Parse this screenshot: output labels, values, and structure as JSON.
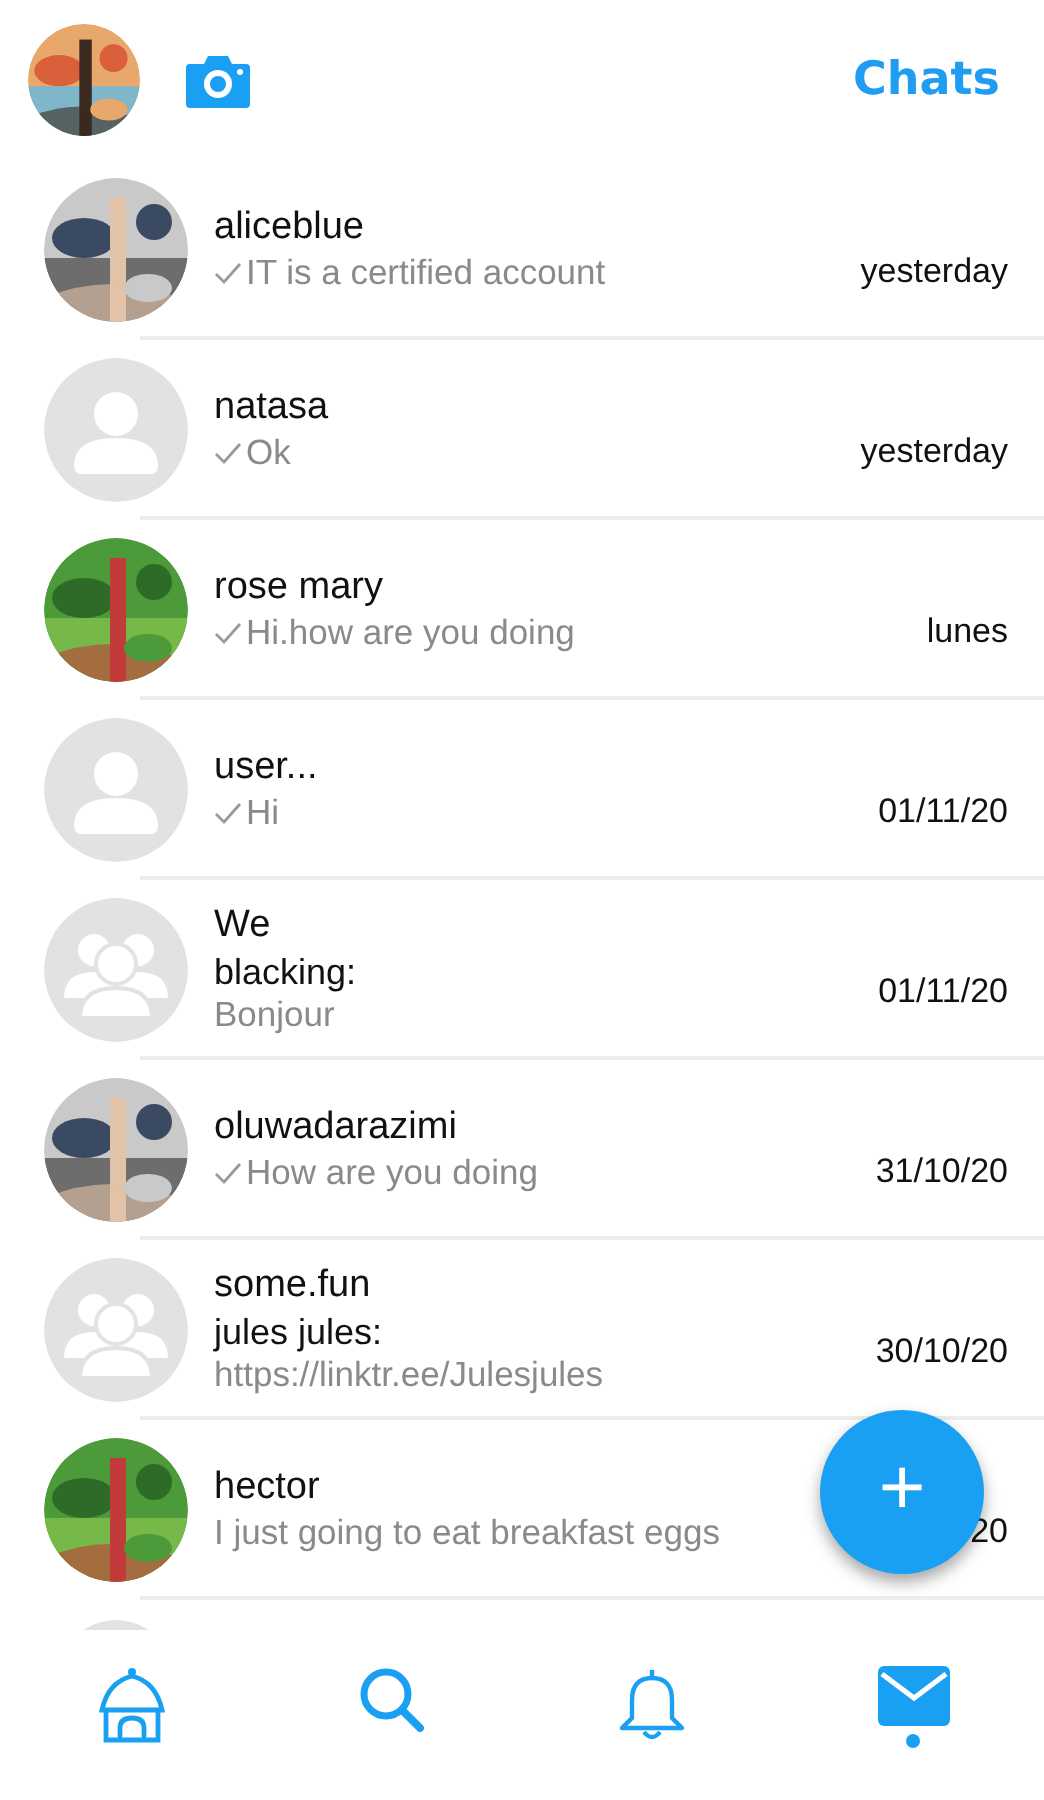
{
  "header": {
    "title": "Chats"
  },
  "chats": [
    {
      "name": "aliceblue",
      "kind": "picture",
      "message": "IT is a certified account",
      "ticked": true,
      "time": "yesterday"
    },
    {
      "name": "natasa",
      "kind": "person",
      "message": "Ok",
      "ticked": true,
      "time": "yesterday"
    },
    {
      "name": "rose mary",
      "kind": "picture",
      "message": "Hi.how are you doing",
      "ticked": true,
      "time": "lunes"
    },
    {
      "name": "user...",
      "kind": "person",
      "message": "Hi",
      "ticked": true,
      "time": "01/11/20"
    },
    {
      "name": "We",
      "kind": "group",
      "sender": "blacking:",
      "message": "Bonjour",
      "ticked": false,
      "time": "01/11/20"
    },
    {
      "name": "oluwadarazimi",
      "kind": "picture",
      "message": "How are you doing",
      "ticked": true,
      "time": "31/10/20"
    },
    {
      "name": "some.fun",
      "kind": "group",
      "sender": "jules jules:",
      "message": "https://linktr.ee/Julesjules",
      "ticked": false,
      "time": "30/10/20"
    },
    {
      "name": "hector",
      "kind": "picture",
      "message": "I just going to eat breakfast eggs",
      "ticked": false,
      "time": "20"
    }
  ],
  "fab": {
    "label": "+"
  },
  "nav": [
    {
      "kind": "home",
      "selected": false
    },
    {
      "kind": "search",
      "selected": false
    },
    {
      "kind": "bell",
      "selected": false
    },
    {
      "kind": "mail",
      "selected": true
    }
  ]
}
